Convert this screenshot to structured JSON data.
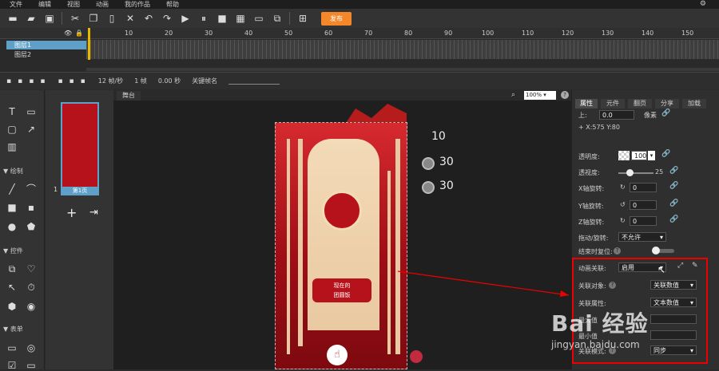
{
  "menu": [
    "文件",
    "编辑",
    "视图",
    "动画",
    "我的作品",
    "帮助"
  ],
  "toolbar": {
    "publish": "发布"
  },
  "timeline": {
    "ticks": [
      "10",
      "20",
      "30",
      "40",
      "50",
      "60",
      "70",
      "80",
      "90",
      "100",
      "110",
      "120",
      "130",
      "140",
      "150"
    ],
    "layers": [
      "图层1",
      "图层2"
    ],
    "footer": {
      "fps": "12 帧/秒",
      "frame": "1 帧",
      "time": "0.00 秒",
      "keyframe_label": "关键帧名"
    }
  },
  "tools": {
    "draw": "绘制",
    "widgets": "控件",
    "form": "表单"
  },
  "pages": {
    "index": "1",
    "label": "第1页"
  },
  "stage": {
    "tab": "舞台",
    "zoom": "100%",
    "help": "?",
    "nums": [
      "10",
      "30",
      "30"
    ],
    "poster_title": "现在的",
    "poster_sub": "团圆饭"
  },
  "props": {
    "tabs": [
      "属性",
      "元件",
      "翻页",
      "分享",
      "加载"
    ],
    "top_label": "上:",
    "top_value": "0.0",
    "top_unit": "像素",
    "coords": "+ X:575   Y:80",
    "opacity_label": "透明度:",
    "opacity_value": "100",
    "blur_label": "透视度:",
    "blur_value": "25",
    "xrot_label": "X轴旋转:",
    "xrot_value": "0",
    "yrot_label": "Y轴旋转:",
    "yrot_value": "0",
    "zrot_label": "Z轴旋转:",
    "zrot_value": "0",
    "drag_label": "拖动/旋转:",
    "drag_value": "不允许",
    "reset_label": "结束时复位:",
    "anim_label": "动画关联:",
    "anim_value": "启用",
    "target_label": "关联对象:",
    "target_value": "关联数值",
    "attr_label": "关联属性:",
    "attr_value": "文本数值",
    "max_label": "最大值",
    "min_label": "最小值",
    "mode_label": "关联模式:",
    "mode_value": "同步"
  },
  "watermark": {
    "brand": "Bai  经验",
    "url": "jingyan.baidu.com"
  }
}
